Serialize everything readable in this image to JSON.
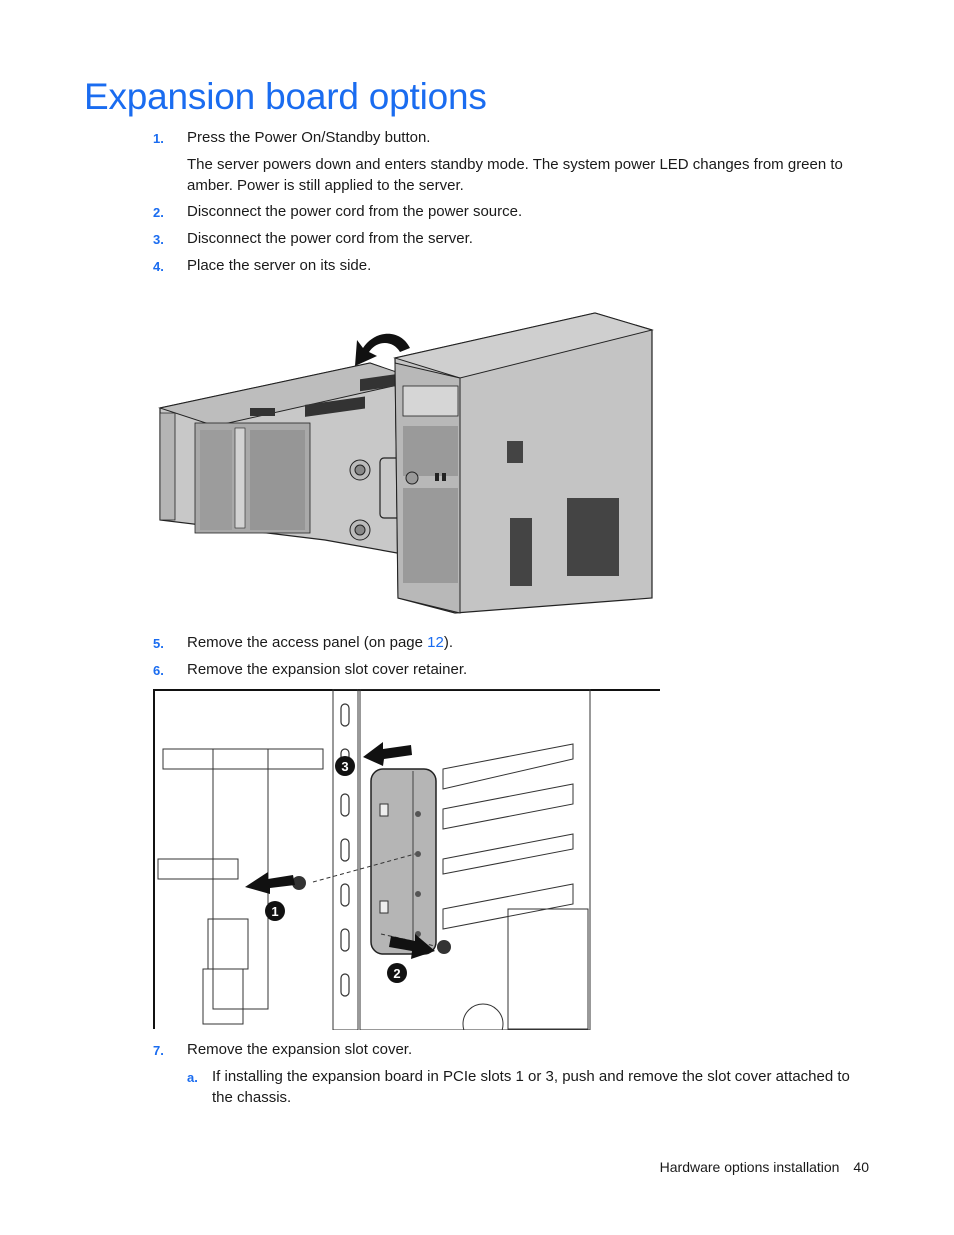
{
  "page": {
    "title": "Expansion board options",
    "steps": [
      {
        "num": "1.",
        "text": "Press the Power On/Standby button."
      },
      {
        "num": "2.",
        "text": "Disconnect the power cord from the power source."
      },
      {
        "num": "3.",
        "text": "Disconnect the power cord from the server."
      },
      {
        "num": "4.",
        "text": "Place the server on its side."
      },
      {
        "num": "5.",
        "text_before": "Remove the access panel (on page ",
        "link": "12",
        "text_after": ")."
      },
      {
        "num": "6.",
        "text": "Remove the expansion slot cover retainer."
      },
      {
        "num": "7.",
        "text": "Remove the expansion slot cover."
      }
    ],
    "step1_note": "The server powers down and enters standby mode. The system power LED changes from green to amber. Power is still applied to the server.",
    "substeps": [
      {
        "num": "a.",
        "text": "If installing the expansion board in PCIe slots 1 or 3, push and remove the slot cover attached to the chassis."
      }
    ],
    "figures": [
      {
        "name": "server-on-side-illustration",
        "description": "Tower server being rotated onto its side"
      },
      {
        "name": "slot-cover-retainer-illustration",
        "description": "Removing the expansion slot cover retainer",
        "callouts": [
          "1",
          "2",
          "3"
        ]
      }
    ],
    "footer": {
      "section": "Hardware options installation",
      "page_number": "40"
    },
    "colors": {
      "accent": "#1a6cf0",
      "text": "#1a1a1a"
    }
  }
}
